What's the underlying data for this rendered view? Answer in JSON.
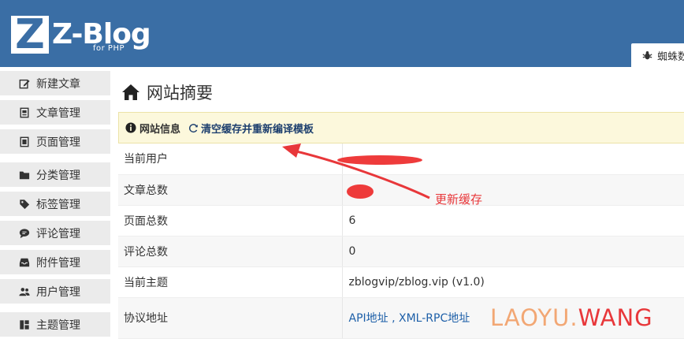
{
  "header": {
    "logo_letter": "Z",
    "logo_text": "Z-Blog",
    "logo_sub": "for PHP",
    "top_tab": "蜘蛛数"
  },
  "sidebar": {
    "items": [
      {
        "label": "新建文章",
        "icon": "pencil-square-icon"
      },
      {
        "label": "文章管理",
        "icon": "document-icon"
      },
      {
        "label": "页面管理",
        "icon": "page-icon"
      },
      {
        "label": "分类管理",
        "icon": "folder-icon"
      },
      {
        "label": "标签管理",
        "icon": "tag-icon"
      },
      {
        "label": "评论管理",
        "icon": "chat-icon"
      },
      {
        "label": "附件管理",
        "icon": "inbox-icon"
      },
      {
        "label": "用户管理",
        "icon": "users-icon"
      },
      {
        "label": "主题管理",
        "icon": "layout-icon"
      }
    ]
  },
  "main": {
    "title": "网站摘要",
    "panel": {
      "title": "网站信息",
      "refresh_link": "清空缓存并重新编译模板"
    },
    "rows": [
      {
        "key": "当前用户",
        "value": ""
      },
      {
        "key": "文章总数",
        "value": ""
      },
      {
        "key": "页面总数",
        "value": "6"
      },
      {
        "key": "评论总数",
        "value": "0"
      },
      {
        "key": "当前主题",
        "value": "zblogvip/zblog.vip (v1.0)"
      },
      {
        "key": "协议地址",
        "api_link": "API地址",
        "separator": " , ",
        "xmlrpc_link": "XML-RPC地址"
      }
    ]
  },
  "annotation": {
    "label": "更新缓存"
  },
  "watermark": {
    "part1": "LAOYU.",
    "part2": "WANG"
  },
  "colors": {
    "header": "#3a6ea5",
    "annotation": "#e8373a",
    "link": "#1d5fa8"
  }
}
